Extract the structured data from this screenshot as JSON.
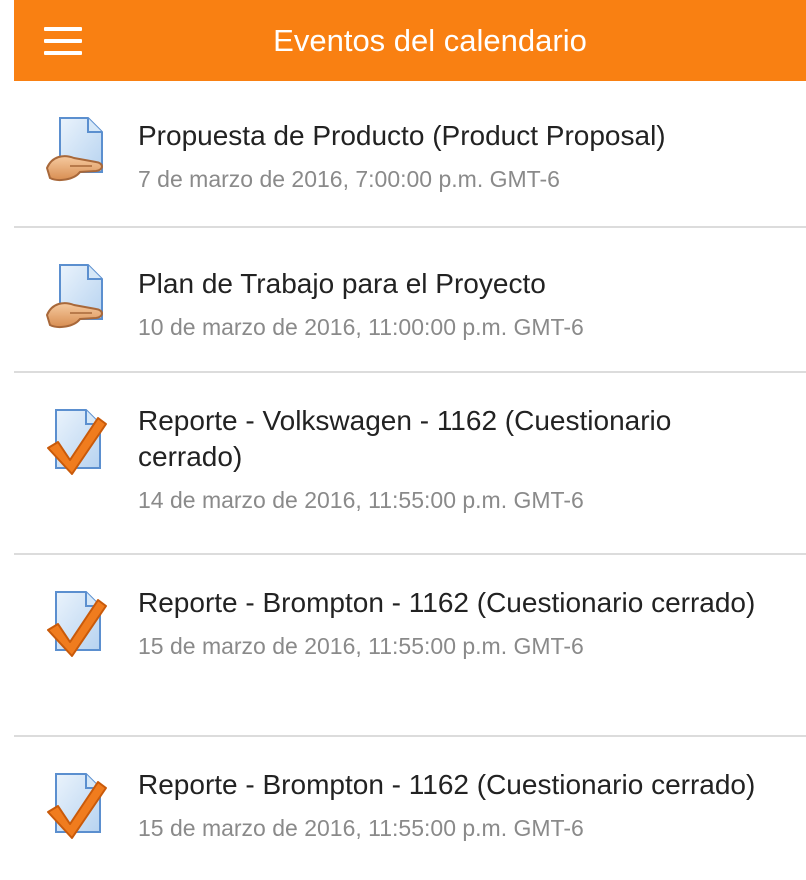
{
  "header": {
    "title": "Eventos del calendario",
    "menu_icon": "hamburger-menu-icon",
    "background_color": "#f98012"
  },
  "events": [
    {
      "name": "Propuesta de Producto (Product Proposal)",
      "date": "7 de marzo de 2016, 7:00:00 p.m. GMT-6",
      "icon": "assignment-icon"
    },
    {
      "name": "Plan de Trabajo para el Proyecto",
      "date": "10 de marzo de 2016, 11:00:00 p.m. GMT-6",
      "icon": "assignment-icon"
    },
    {
      "name": "Reporte - Volkswagen - 1162 (Cuestionario cerrado)",
      "date": "14 de marzo de 2016, 11:55:00 p.m. GMT-6",
      "icon": "quiz-icon"
    },
    {
      "name": "Reporte - Brompton - 1162 (Cuestionario cerrado)",
      "date": "15 de marzo de 2016, 11:55:00 p.m. GMT-6",
      "icon": "quiz-icon"
    },
    {
      "name": "Reporte - Brompton - 1162 (Cuestionario cerrado)",
      "date": "15 de marzo de 2016, 11:55:00 p.m. GMT-6",
      "icon": "quiz-icon"
    }
  ]
}
